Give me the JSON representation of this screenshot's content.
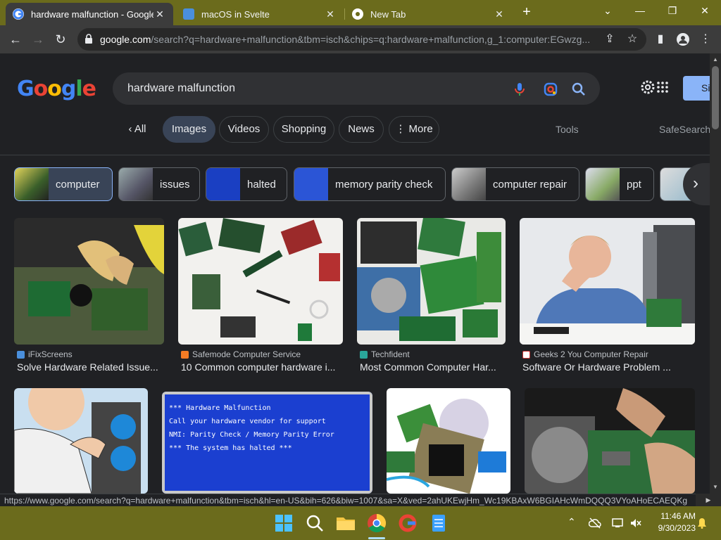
{
  "tabs": [
    {
      "title": "hardware malfunction - Google S",
      "close": "✕"
    },
    {
      "title": "macOS in Svelte",
      "close": "✕"
    },
    {
      "title": "New Tab",
      "close": "✕"
    }
  ],
  "new_tab": "+",
  "window_controls": {
    "dropdown": "⌄",
    "minimize": "—",
    "restore": "❐",
    "close": "✕"
  },
  "toolbar": {
    "url_host": "google.com",
    "url_rest": "/search?q=hardware+malfunction&tbm=isch&chips=q:hardware+malfunction,g_1:computer:EGwzg..."
  },
  "search": {
    "logo": "Google",
    "query": "hardware malfunction",
    "signin": "Si"
  },
  "filters": {
    "all": "All",
    "tabs": [
      "Images",
      "Videos",
      "Shopping",
      "News",
      "More"
    ],
    "tools": "Tools",
    "safesearch": "SafeSearch"
  },
  "chips": [
    "computer",
    "issues",
    "halted",
    "memory parity check",
    "computer repair",
    "ppt"
  ],
  "results": [
    {
      "source": "iFixScreens",
      "title": "Solve Hardware Related Issue..."
    },
    {
      "source": "Safemode Computer Service",
      "title": "10 Common computer hardware i..."
    },
    {
      "source": "Techfident",
      "title": "Most Common Computer Har..."
    },
    {
      "source": "Geeks 2 You Computer Repair",
      "title": "Software Or Hardware Problem ..."
    }
  ],
  "bsod": {
    "lines": [
      "*** Hardware Malfunction",
      "Call your hardware vendor for support",
      "NMI: Parity Check / Memory Parity Error",
      "*** The system has halted ***"
    ]
  },
  "statusbar": "https://www.google.com/search?q=hardware+malfunction&tbm=isch&hl=en-US&bih=626&biw=1007&sa=X&ved=2ahUKEwjHm_Wc19KBAxW6BGIAHcWmDQQQ3VYoAHoECAEQKg",
  "taskbar": {
    "time": "11:46 AM",
    "date": "9/30/2023"
  },
  "colors": {
    "tabbar": "#6b6b1c",
    "page_bg": "#202124",
    "accent": "#8ab4f8",
    "active_chip": "#394457"
  }
}
